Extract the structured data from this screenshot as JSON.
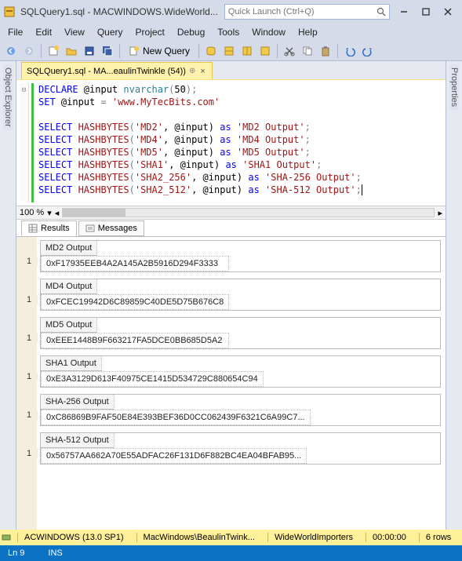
{
  "title": "SQLQuery1.sql - MACWINDOWS.WideWorld...",
  "quick_launch": {
    "placeholder": "Quick Launch (Ctrl+Q)"
  },
  "menu": {
    "file": "File",
    "edit": "Edit",
    "view": "View",
    "query": "Query",
    "project": "Project",
    "debug": "Debug",
    "tools": "Tools",
    "window": "Window",
    "help": "Help"
  },
  "toolbar": {
    "new_query": "New Query"
  },
  "left_panel": "Object Explorer",
  "right_panel": "Properties",
  "editor_tab": "SQLQuery1.sql - MA...eaulinTwinkle (54))",
  "zoom": "100 %",
  "sql": {
    "l1a": "DECLARE",
    "l1b": " @input ",
    "l1c": "nvarchar",
    "l1d": "(",
    "l1e": "50",
    "l1f": ");",
    "l2a": "SET",
    "l2b": " @input ",
    "l2c": "=",
    "l2d": " 'www.MyTecBits.com'",
    "l3a": "SELECT ",
    "l3b": "HASHBYTES",
    "l3c": "(",
    "l3d": "'MD2'",
    "l3e": ", @input) ",
    "l3f": "as",
    "l3g": " 'MD2 Output'",
    "l3h": ";",
    "l4d": "'MD4'",
    "l4g": " 'MD4 Output'",
    "l5d": "'MD5'",
    "l5g": " 'MD5 Output'",
    "l6d": "'SHA1'",
    "l6g": " 'SHA1 Output'",
    "l7d": "'SHA2_256'",
    "l7g": " 'SHA-256 Output'",
    "l8d": "'SHA2_512'",
    "l8g": " 'SHA-512 Output'"
  },
  "result_tabs": {
    "results": "Results",
    "messages": "Messages"
  },
  "row_index": "1",
  "results": [
    {
      "header": "MD2 Output",
      "value": "0xF17935EEB4A2A145A2B5916D294F3333"
    },
    {
      "header": "MD4 Output",
      "value": "0xFCEC19942D6C89859C40DE5D75B676C8"
    },
    {
      "header": "MD5 Output",
      "value": "0xEEE1448B9F663217FA5DCE0BB685D5A2"
    },
    {
      "header": "SHA1 Output",
      "value": "0xE3A3129D613F40975CE1415D534729C880654C94"
    },
    {
      "header": "SHA-256 Output",
      "value": "0xC86869B9FAF50E84E393BEF36D0CC062439F6321C6A99C7..."
    },
    {
      "header": "SHA-512 Output",
      "value": "0x56757AA662A70E55ADFAC26F131D6F882BC4EA04BFAB95..."
    }
  ],
  "status_yellow": {
    "server": "ACWINDOWS (13.0 SP1)",
    "user": "MacWindows\\BeaulinTwink...",
    "db": "WideWorldImporters",
    "time": "00:00:00",
    "rows": "6 rows"
  },
  "status_blue": {
    "ln": "Ln 9",
    "ins": "INS"
  }
}
